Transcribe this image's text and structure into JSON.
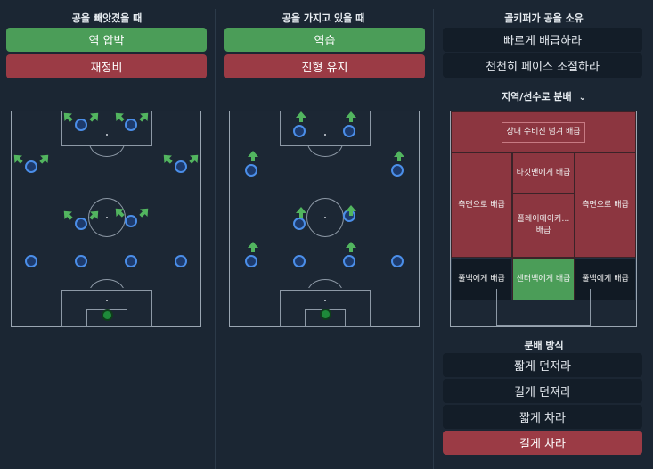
{
  "col1": {
    "header": "공을 빼앗겼을 때",
    "btn_a": "역 압박",
    "btn_b": "재정비"
  },
  "col2": {
    "header": "공을 가지고 있을 때",
    "btn_a": "역습",
    "btn_b": "진형 유지"
  },
  "col3": {
    "header": "골키퍼가 공을 소유",
    "btn_a": "빠르게 배급하라",
    "btn_b": "천천히 페이스 조절하라",
    "dropdown": "지역/선수로 분배",
    "zones": {
      "top": "상대 수비진 넘겨 배급",
      "left": "측면으로 배급",
      "right": "측면으로 배급",
      "target": "타깃맨에게 배급",
      "playmaker": "플레이메이커… 배급",
      "fb_left": "풀백에게 배급",
      "fb_right": "풀백에게 배급",
      "cb": "센터백에게 배급"
    },
    "dist_header": "분배 방식",
    "dist": [
      "짧게 던져라",
      "길게 던져라",
      "짧게 차라",
      "길게 차라"
    ]
  },
  "colors": {
    "green": "#4b9d58",
    "red": "#9b3b45",
    "dark": "#131d28",
    "player": "#4b8ee8"
  }
}
